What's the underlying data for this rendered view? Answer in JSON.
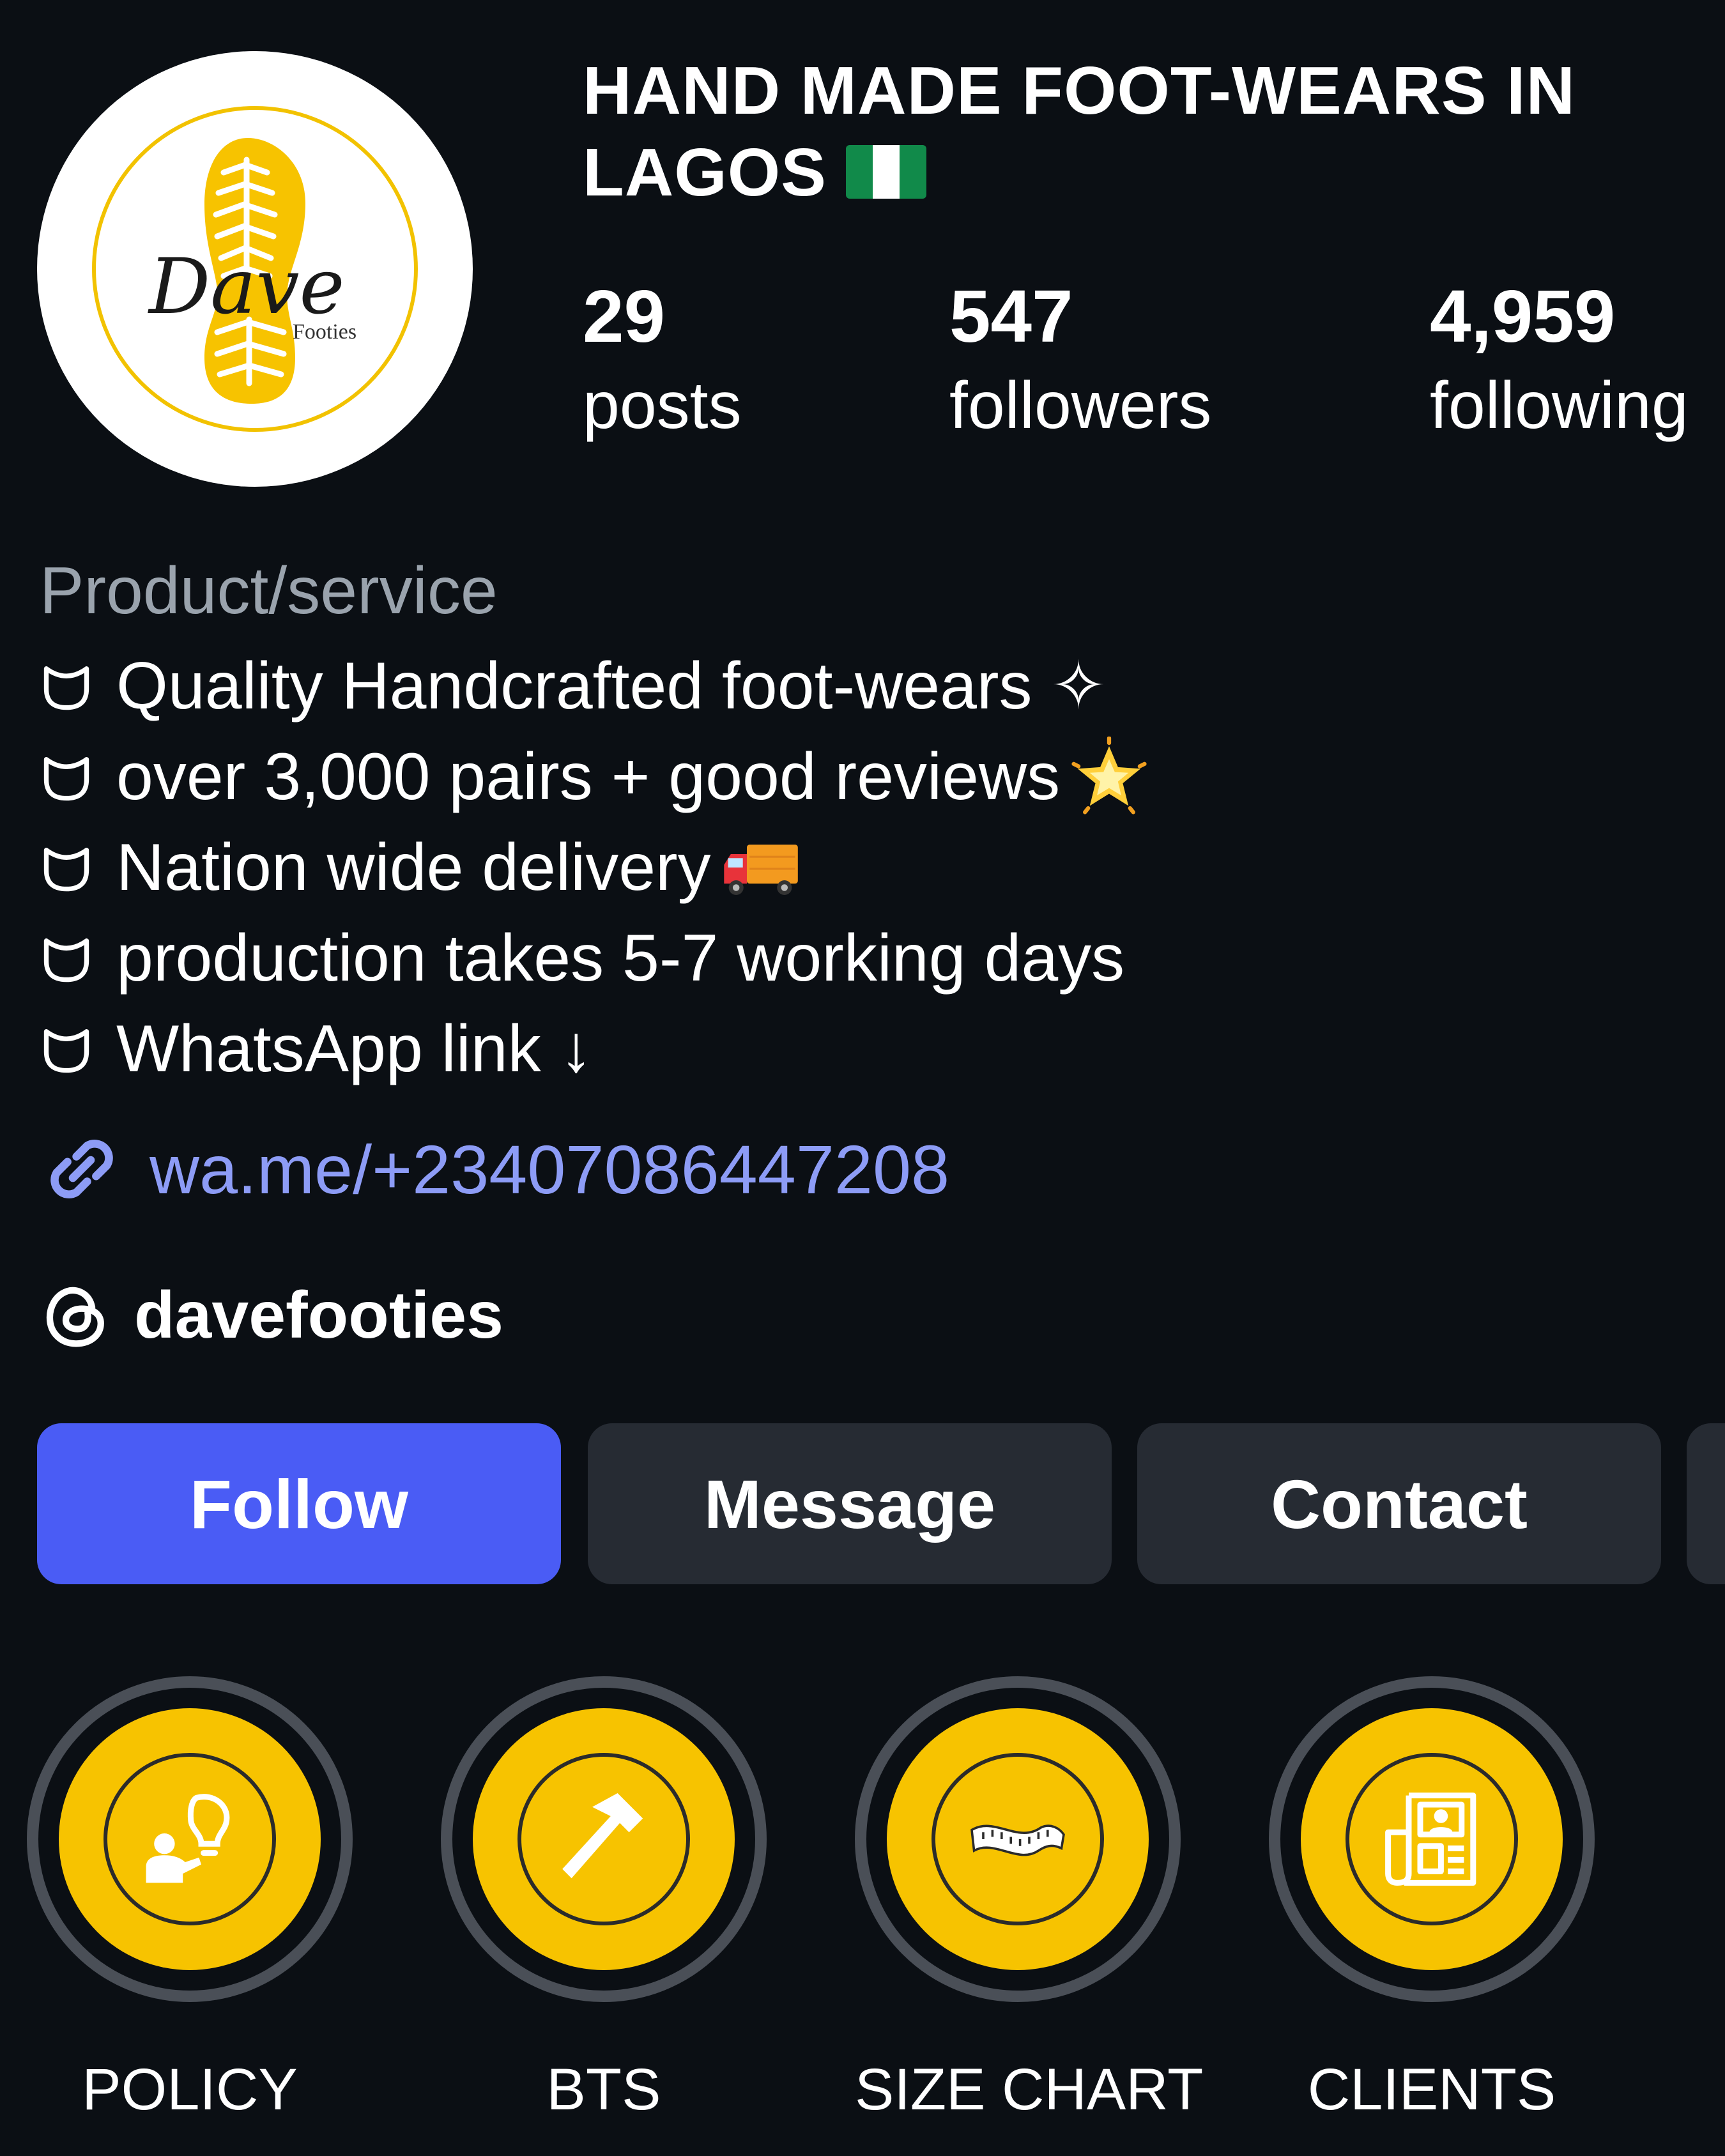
{
  "profile": {
    "name": "HAND MADE FOOT-WEARS IN LAGOS",
    "name_emoji": "nigeria-flag",
    "avatar_logo_text": "Dave",
    "avatar_logo_subtext": "Footies",
    "category": "Product/service"
  },
  "stats": [
    {
      "value": "29",
      "label": "posts"
    },
    {
      "value": "547",
      "label": "followers"
    },
    {
      "value": "4,959",
      "label": "following"
    }
  ],
  "bio": {
    "lines": [
      {
        "text": "Quality Handcrafted foot-wears ✧",
        "icon": "shoe-sole-icon",
        "trailing_emoji": ""
      },
      {
        "text": "over 3,000 pairs + good reviews",
        "icon": "shoe-sole-icon",
        "trailing_emoji": "glowing-star"
      },
      {
        "text": "Nation wide delivery ",
        "icon": "shoe-sole-icon",
        "trailing_emoji": "delivery-truck"
      },
      {
        "text": "production takes 5-7 working days",
        "icon": "shoe-sole-icon",
        "trailing_emoji": ""
      },
      {
        "text": "WhatsApp link ↓",
        "icon": "shoe-sole-icon",
        "trailing_emoji": ""
      }
    ],
    "link": "wa.me/+23407086447208",
    "threads_handle": "davefooties"
  },
  "buttons": {
    "follow": "Follow",
    "message": "Message",
    "contact": "Contact"
  },
  "highlights": [
    {
      "label": "POLICY",
      "icon": "policy-person-bulb-icon"
    },
    {
      "label": "BTS",
      "icon": "hammer-icon"
    },
    {
      "label": "SIZE CHART",
      "icon": "measuring-tape-icon"
    },
    {
      "label": "CLIENTS",
      "icon": "newspaper-icon"
    }
  ],
  "colors": {
    "background": "#0b0f14",
    "follow_button": "#4a5cf5",
    "secondary_button": "#262b33",
    "link": "#8d9cf6",
    "highlight_fill": "#f7c300",
    "category_text": "#9aa3ad"
  }
}
